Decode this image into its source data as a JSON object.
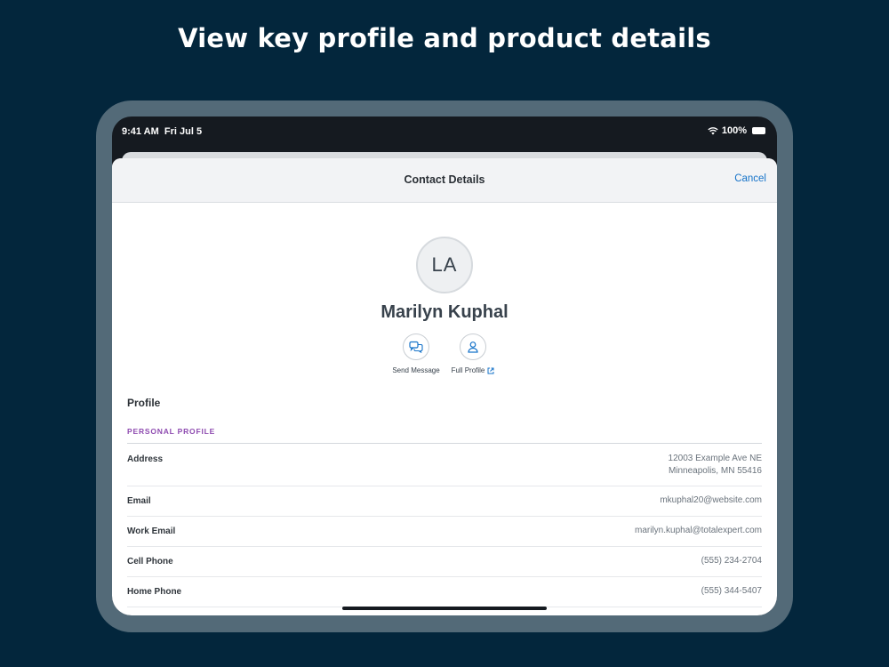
{
  "headline": "View key profile and product details",
  "status_bar": {
    "time": "9:41 AM",
    "date": "Fri Jul 5",
    "battery": "100%",
    "icons": [
      "wifi-icon",
      "battery-icon"
    ]
  },
  "navbar": {
    "title": "Contact Details",
    "cancel_label": "Cancel"
  },
  "contact": {
    "initials": "LA",
    "name": "Marilyn Kuphal"
  },
  "actions": [
    {
      "label": "Send Message",
      "icon": "chat-bubbles-icon"
    },
    {
      "label": "Full Profile",
      "icon": "person-icon",
      "trailing_icon": "external-link-icon"
    }
  ],
  "profile": {
    "section_title": "Profile",
    "subsection_title": "PERSONAL PROFILE",
    "rows": [
      {
        "label": "Address",
        "value_line1": "12003 Example Ave NE",
        "value_line2": "Minneapolis, MN 55416"
      },
      {
        "label": "Email",
        "value_line1": "mkuphal20@website.com"
      },
      {
        "label": "Work Email",
        "value_line1": "marilyn.kuphal@totalexpert.com"
      },
      {
        "label": "Cell Phone",
        "value_line1": "(555) 234-2704"
      },
      {
        "label": "Home Phone",
        "value_line1": "(555) 344-5407"
      }
    ]
  },
  "colors": {
    "background": "#03263c",
    "device_frame": "#536a78",
    "accent_blue": "#1673c9",
    "subsection_purple": "#8e4bb0"
  }
}
